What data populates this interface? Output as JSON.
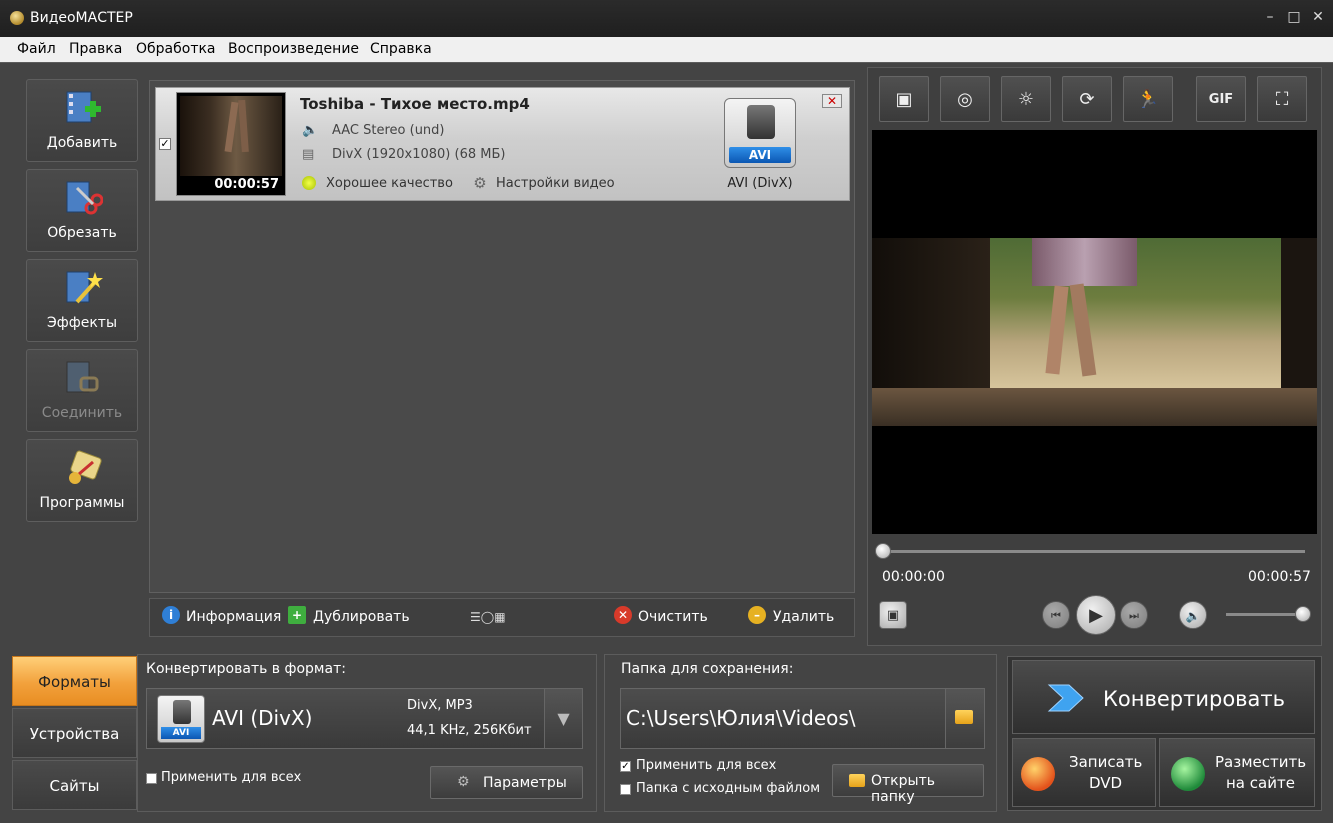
{
  "window": {
    "title": "ВидеоМАСТЕР",
    "minimize": "–",
    "maximize": "□",
    "close": "✕"
  },
  "menu": [
    "Файл",
    "Правка",
    "Обработка",
    "Воспроизведение",
    "Справка"
  ],
  "tools": [
    {
      "label": "Добавить",
      "icon": "film-add-icon",
      "enabled": true
    },
    {
      "label": "Обрезать",
      "icon": "film-cut-icon",
      "enabled": true
    },
    {
      "label": "Эффекты",
      "icon": "effects-wand-icon",
      "enabled": true
    },
    {
      "label": "Соединить",
      "icon": "film-join-icon",
      "enabled": false
    },
    {
      "label": "Программы",
      "icon": "programs-icon",
      "enabled": true
    }
  ],
  "file": {
    "checked": true,
    "name": "Toshiba - Тихое место.mp4",
    "duration": "00:00:57",
    "audio": "AAC Stereo (und)",
    "video": "DivX (1920x1080) (68 МБ)",
    "quality": "Хорошее качество",
    "settings": "Настройки видео",
    "format_tag": "AVI",
    "format_caption": "AVI (DivX)"
  },
  "actions": {
    "info": "Информация",
    "duplicate": "Дублировать",
    "clear": "Очистить",
    "delete": "Удалить"
  },
  "effects_toolbar": [
    "crop-icon",
    "stabilize-icon",
    "brightness-icon",
    "rotate-icon",
    "speed-icon",
    "gif-icon",
    "fullscreen-icon"
  ],
  "effects_gif_label": "GIF",
  "player": {
    "time_current": "00:00:00",
    "time_total": "00:00:57",
    "progress": 0,
    "volume": 1.0
  },
  "tabs": [
    "Форматы",
    "Устройства",
    "Сайты"
  ],
  "active_tab": 0,
  "format_panel": {
    "label": "Конвертировать в формат:",
    "format_name": "AVI (DivX)",
    "format_tag": "AVI",
    "codecs": "DivX, MP3",
    "audio": "44,1 KHz, 256Кбит",
    "apply_all": "Применить для всех",
    "params": "Параметры"
  },
  "save_panel": {
    "label": "Папка для сохранения:",
    "path": "C:\\Users\\Юлия\\Videos\\",
    "apply_all": "Применить для всех",
    "apply_all_checked": true,
    "source_folder": "Папка с исходным файлом",
    "source_folder_checked": false,
    "open_folder": "Открыть папку"
  },
  "convert": {
    "main": "Конвертировать",
    "dvd_line1": "Записать",
    "dvd_line2": "DVD",
    "web_line1": "Разместить",
    "web_line2": "на сайте"
  },
  "colors": {
    "accent_tab": "#f2a13c",
    "avi_blue": "#0b57b3"
  }
}
